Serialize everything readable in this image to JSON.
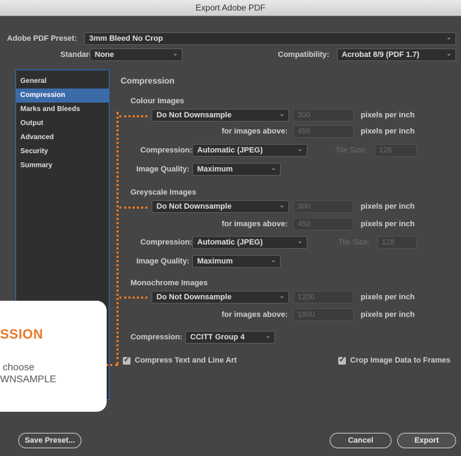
{
  "window": {
    "title": "Export Adobe PDF"
  },
  "preset": {
    "label": "Adobe PDF Preset:",
    "value": "3mm Bleed No Crop"
  },
  "standard": {
    "label": "Standard:",
    "value": "None"
  },
  "compatibility": {
    "label": "Compatibility:",
    "value": "Acrobat 8/9 (PDF 1.7)"
  },
  "sidebar": {
    "items": [
      {
        "label": "General"
      },
      {
        "label": "Compression"
      },
      {
        "label": "Marks and Bleeds"
      },
      {
        "label": "Output"
      },
      {
        "label": "Advanced"
      },
      {
        "label": "Security"
      },
      {
        "label": "Summary"
      }
    ]
  },
  "main": {
    "title": "Compression",
    "colour": {
      "header": "Colour Images",
      "downsample": "Do Not Downsample",
      "ppi": "300",
      "ppi_unit": "pixels per inch",
      "above_label": "for images above:",
      "above": "450",
      "compression_label": "Compression:",
      "compression": "Automatic (JPEG)",
      "tile_label": "Tile Size:",
      "tile": "128",
      "quality_label": "Image Quality:",
      "quality": "Maximum"
    },
    "grey": {
      "header": "Greyscale Images",
      "downsample": "Do Not Downsample",
      "ppi": "300",
      "ppi_unit": "pixels per inch",
      "above_label": "for images above:",
      "above": "450",
      "compression_label": "Compression:",
      "compression": "Automatic (JPEG)",
      "tile_label": "Tile Size:",
      "tile": "128",
      "quality_label": "Image Quality:",
      "quality": "Maximum"
    },
    "mono": {
      "header": "Monochrome Images",
      "downsample": "Do Not Downsample",
      "ppi": "1200",
      "ppi_unit": "pixels per inch",
      "above_label": "for images above:",
      "above": "1800",
      "compression_label": "Compression:",
      "compression": "CCITT Group 4"
    },
    "compress_text": "Compress Text and Line Art",
    "crop_image": "Crop Image Data to Frames"
  },
  "buttons": {
    "save_preset": "Save Preset...",
    "cancel": "Cancel",
    "export": "Export"
  },
  "overlay": {
    "title": "SSION",
    "text": " choose\nWNSAMPLE"
  },
  "colors": {
    "accent": "#e8792a",
    "selection": "#3c6ca8"
  }
}
